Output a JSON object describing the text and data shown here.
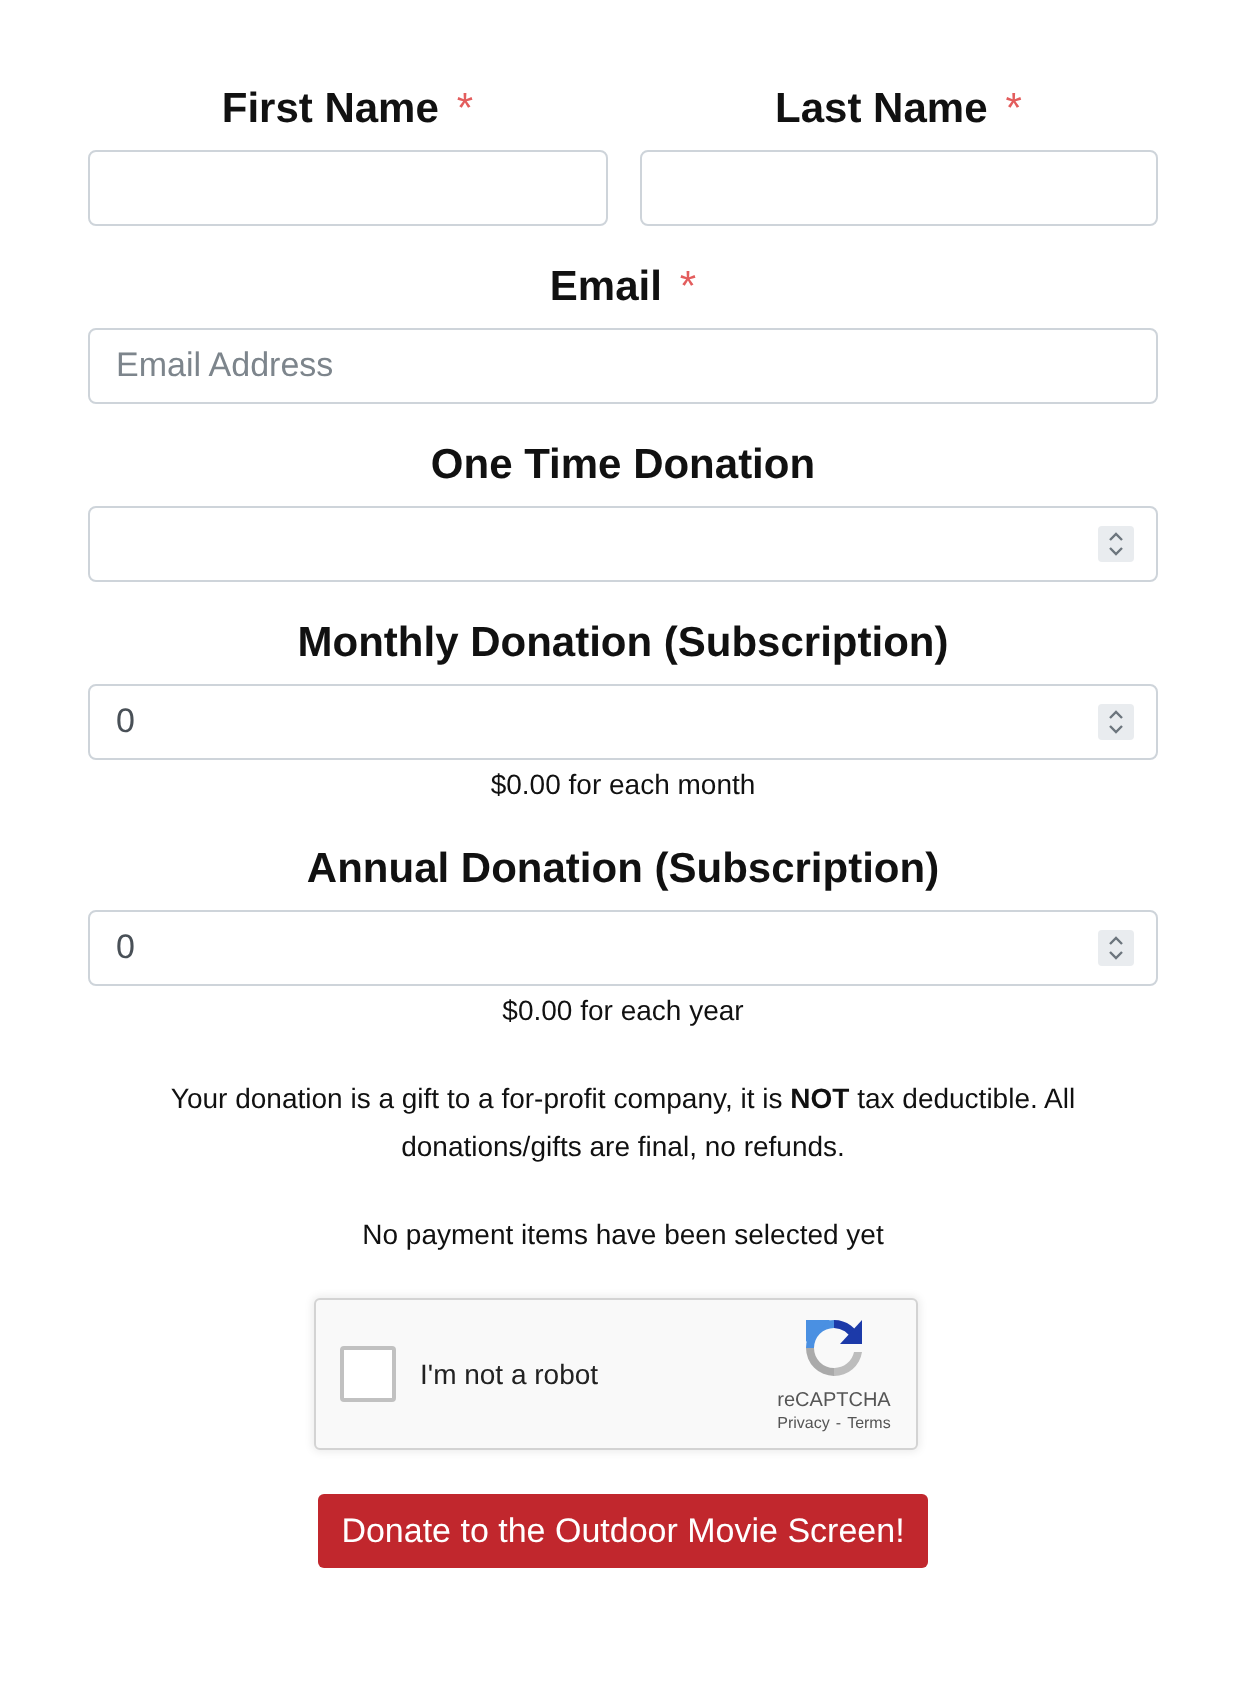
{
  "name_row": [
    {
      "label": "First Name",
      "required_mark": "*"
    },
    {
      "label": "Last Name",
      "required_mark": "*"
    }
  ],
  "fields": [
    {
      "kind": "email",
      "label": "Email",
      "required_mark": "*",
      "placeholder": "Email Address"
    },
    {
      "kind": "number",
      "label": "One Time Donation"
    },
    {
      "kind": "number",
      "label": "Monthly Donation (Subscription)",
      "value": "0",
      "caption": "$0.00 for each month"
    },
    {
      "kind": "number",
      "label": "Annual Donation (Subscription)",
      "value": "0",
      "caption": "$0.00 for each year"
    }
  ],
  "notice": "Your donation is a gift to a for-profit company, it is **NOT** tax deductible. All donations/gifts are final, no refunds.",
  "status": "No payment items have been selected yet",
  "captcha": {
    "label": "I'm not a robot",
    "checked": false,
    "brand": "reCAPTCHA",
    "links": [
      "Privacy",
      "Terms"
    ],
    "separator": "-"
  },
  "submit": "Donate to the Outdoor Movie Screen!"
}
